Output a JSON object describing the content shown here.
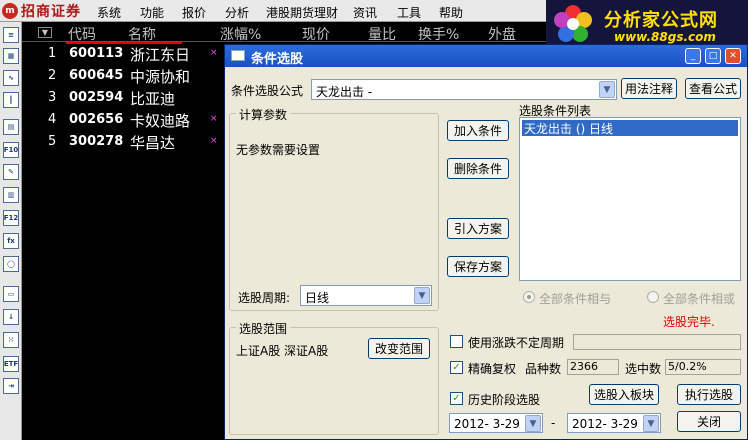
{
  "app": {
    "logo_mark": "m",
    "logo_text": "招商证券",
    "menu": [
      "系统",
      "功能",
      "报价",
      "分析",
      "港股期货理财",
      "资讯",
      "工具",
      "帮助"
    ]
  },
  "watermark": {
    "title": "分析家公式网",
    "url": "www.88gs.com"
  },
  "toolbar_icons": [
    {
      "icon": "quote-list-icon",
      "glyph": "≡"
    },
    {
      "icon": "grid-icon",
      "glyph": "▦"
    },
    {
      "icon": "line-chart-icon",
      "glyph": "∿"
    },
    {
      "icon": "candlestick-icon",
      "glyph": "┃"
    },
    {
      "icon": "report-icon",
      "glyph": "▤"
    },
    {
      "icon": "f10-icon",
      "glyph": "F10"
    },
    {
      "icon": "notes-icon",
      "glyph": "✎"
    },
    {
      "icon": "document-icon",
      "glyph": "▥"
    },
    {
      "icon": "f12-icon",
      "glyph": "F12"
    },
    {
      "icon": "formula-icon",
      "glyph": "fx"
    },
    {
      "icon": "search-icon",
      "glyph": "◯"
    },
    {
      "icon": "folder-icon",
      "glyph": "▭"
    },
    {
      "icon": "sort-icon",
      "glyph": "↓"
    },
    {
      "icon": "dice-icon",
      "glyph": "⁙"
    },
    {
      "icon": "etf-icon",
      "glyph": "ETF"
    },
    {
      "icon": "exit-icon",
      "glyph": "⇥"
    }
  ],
  "stock_list": {
    "headers": [
      "代码",
      "名称",
      "涨幅%",
      "现价",
      "量比",
      "换手%",
      "外盘"
    ],
    "rows": [
      {
        "idx": "1",
        "code": "600113",
        "name": "浙江东日",
        "mark": "×"
      },
      {
        "idx": "2",
        "code": "600645",
        "name": "中源协和",
        "mark": ""
      },
      {
        "idx": "3",
        "code": "002594",
        "name": "比亚迪",
        "mark": ""
      },
      {
        "idx": "4",
        "code": "002656",
        "name": "卡奴迪路",
        "mark": "×"
      },
      {
        "idx": "5",
        "code": "300278",
        "name": "华昌达",
        "mark": "×"
      }
    ]
  },
  "dialog": {
    "title": "条件选股",
    "formula_label": "条件选股公式",
    "formula_value": "天龙出击 -",
    "usage_button": "用法注释",
    "view_formula_button": "查看公式",
    "calc_params_title": "计算参数",
    "no_params_text": "无参数需要设置",
    "period_label": "选股周期:",
    "period_value": "日线",
    "add_condition_button": "加入条件",
    "delete_condition_button": "删除条件",
    "import_plan_button": "引入方案",
    "save_plan_button": "保存方案",
    "condition_list_label": "选股条件列表",
    "condition_item": "天龙出击  ()  日线",
    "all_and_label": "全部条件相与",
    "all_or_label": "全部条件相或",
    "status_text": "选股完毕.",
    "status_color": "#e00000",
    "range_title": "选股范围",
    "range_value": "上证A股 深证A股",
    "change_range_button": "改变范围",
    "use_uncertain_label": "使用涨跌不定周期",
    "exact_rights_label": "精确复权",
    "count_label": "品种数",
    "count_value": "2366",
    "selected_label": "选中数",
    "selected_value": "5/0.2%",
    "history_label": "历史阶段选股",
    "add_to_block_button": "选股入板块",
    "execute_button": "执行选股",
    "date_from": "2012- 3-29",
    "date_sep": "-",
    "date_to": "2012- 3-29",
    "close_button": "关闭"
  }
}
